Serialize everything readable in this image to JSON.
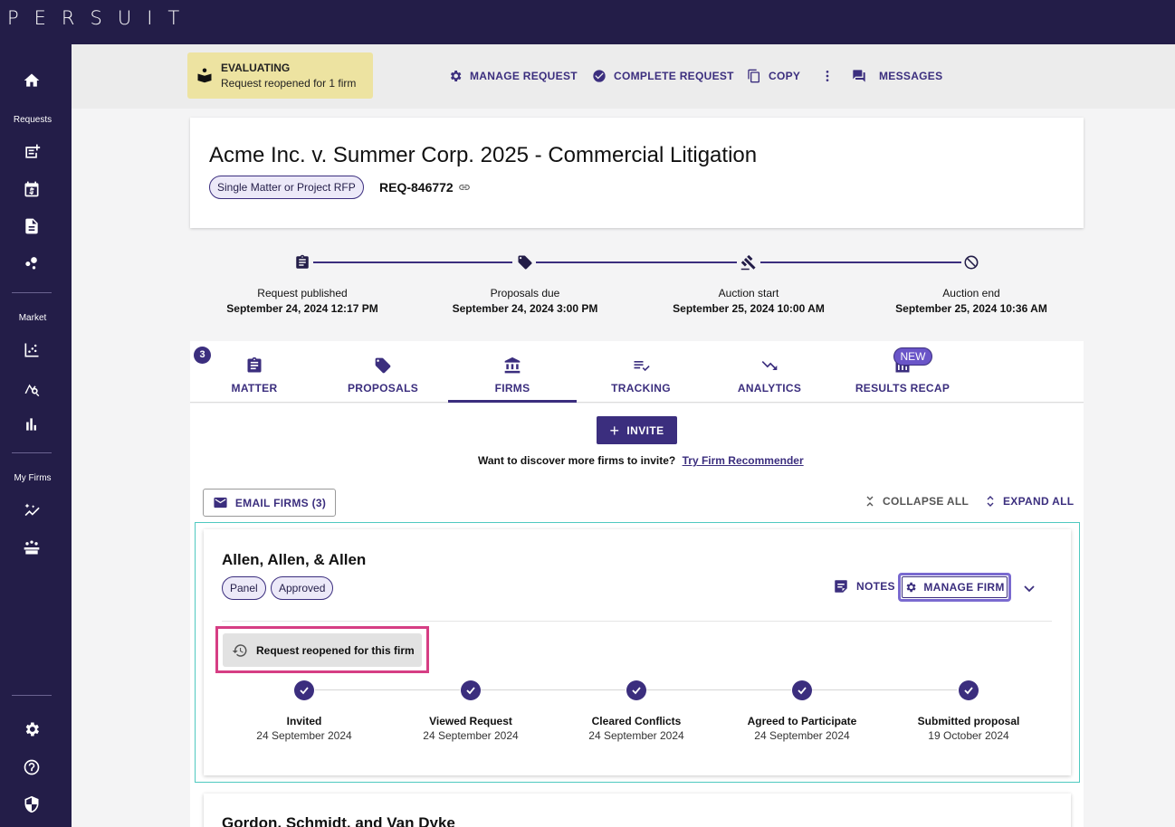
{
  "app": {
    "logo": "PERSUIT"
  },
  "sidebar": {
    "sections": [
      "Requests",
      "Market",
      "My Firms"
    ],
    "icons": [
      "home-icon",
      "new-request-icon",
      "calendar-dollar-icon",
      "document-icon",
      "bubbles-icon",
      "scatter-chart-icon",
      "search-chart-icon",
      "bar-chart-icon",
      "sparkle-trend-icon",
      "firms-group-icon",
      "settings-icon",
      "help-icon",
      "shield-icon"
    ]
  },
  "status": {
    "title": "EVALUATING",
    "subtitle": "Request reopened for 1 firm"
  },
  "actions": {
    "manage_request": "MANAGE REQUEST",
    "complete_request": "COMPLETE REQUEST",
    "copy": "COPY",
    "messages": "MESSAGES"
  },
  "request": {
    "title": "Acme Inc. v. Summer Corp. 2025 - Commercial Litigation",
    "type_chip": "Single Matter or Project RFP",
    "id": "REQ-846772"
  },
  "timeline": [
    {
      "label": "Request published",
      "date": "September 24, 2024 12:17 PM",
      "icon": "clipboard-icon"
    },
    {
      "label": "Proposals due",
      "date": "September 24, 2024 3:00 PM",
      "icon": "tag-icon"
    },
    {
      "label": "Auction start",
      "date": "September 25, 2024 10:00 AM",
      "icon": "gavel-icon"
    },
    {
      "label": "Auction end",
      "date": "September 25, 2024 10:36 AM",
      "icon": "blocked-icon"
    }
  ],
  "tabs": [
    {
      "label": "MATTER"
    },
    {
      "label": "PROPOSALS",
      "badge": "3"
    },
    {
      "label": "FIRMS",
      "active": true
    },
    {
      "label": "TRACKING"
    },
    {
      "label": "ANALYTICS"
    },
    {
      "label": "RESULTS RECAP",
      "badge": "NEW"
    }
  ],
  "firms_panel": {
    "invite": "INVITE",
    "discover_text": "Want to discover more firms to invite?",
    "discover_link": "Try Firm Recommender",
    "email_firms": "EMAIL FIRMS (3)",
    "collapse_all": "COLLAPSE ALL",
    "expand_all": "EXPAND ALL"
  },
  "firms": [
    {
      "name": "Allen, Allen, & Allen",
      "chips": [
        "Panel",
        "Approved"
      ],
      "notes": "NOTES",
      "manage": "MANAGE FIRM",
      "reopened": "Request reopened for this firm",
      "steps": [
        {
          "title": "Invited",
          "date": "24 September 2024"
        },
        {
          "title": "Viewed Request",
          "date": "24 September 2024"
        },
        {
          "title": "Cleared Conflicts",
          "date": "24 September 2024"
        },
        {
          "title": "Agreed to Participate",
          "date": "24 September 2024"
        },
        {
          "title": "Submitted proposal",
          "date": "19 October 2024"
        }
      ]
    },
    {
      "name": "Gordon, Schmidt, and Van Dyke"
    }
  ],
  "colors": {
    "brand": "#231d48",
    "accent": "#3b2e7e",
    "status_bg": "#ede3a1",
    "highlight": "#d63e84",
    "focus": "#4fc9c0"
  }
}
